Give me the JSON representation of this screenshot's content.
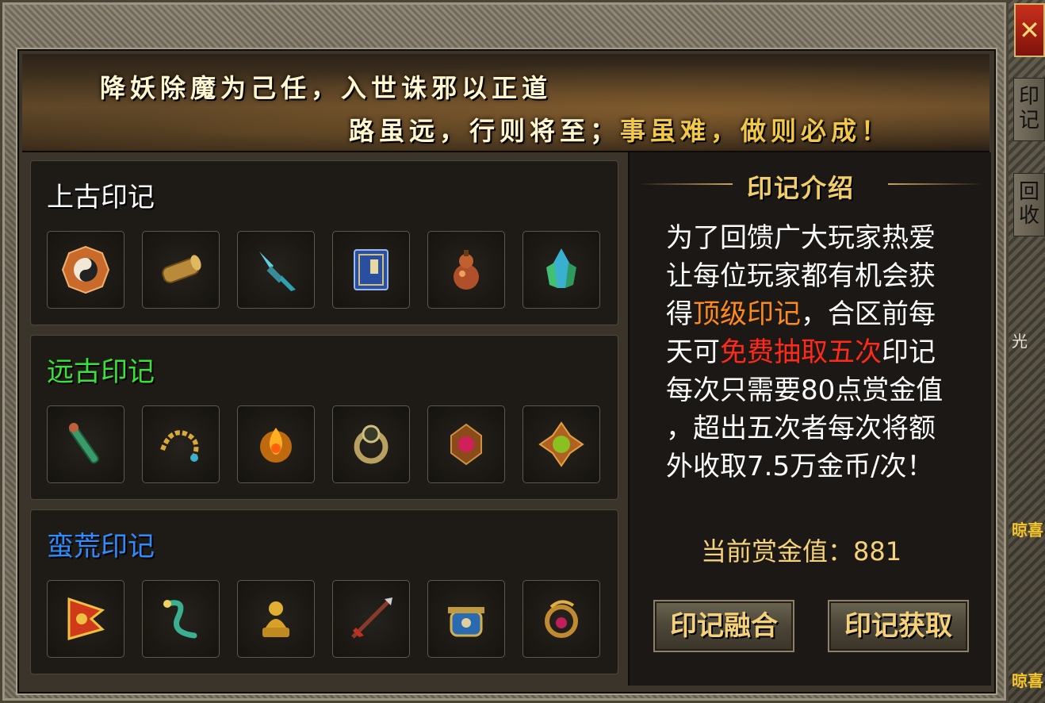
{
  "banner": {
    "line1": "降妖除魔为己任，入世诛邪以正道",
    "line2_a": "路虽远，行则将至；",
    "line2_b": "事虽难，做则必成！"
  },
  "groups": [
    {
      "title": "上古印记",
      "color": "#ffffff",
      "items": [
        "bagua-icon",
        "scroll-icon",
        "dagger-icon",
        "book-icon",
        "gourd-icon",
        "crystal-icon"
      ]
    },
    {
      "title": "远古印记",
      "color": "#39e23a",
      "items": [
        "jade-staff-icon",
        "beads-icon",
        "flame-emblem-icon",
        "ring-icon",
        "ruby-emblem-icon",
        "peridot-emblem-icon"
      ]
    },
    {
      "title": "蛮荒印记",
      "color": "#2f8cff",
      "items": [
        "banner-flag-icon",
        "serpent-icon",
        "buddha-statue-icon",
        "spear-icon",
        "cauldron-icon",
        "dragon-ring-icon"
      ]
    }
  ],
  "intro": {
    "title": "印记介绍",
    "l1": "为了回馈广大玩家热爱",
    "l2": "让每位玩家都有机会获",
    "l3_a": "得",
    "l3_b": "顶级印记",
    "l3_c": "，合区前每",
    "l4_a": "天可",
    "l4_b": "免费抽取五次",
    "l4_c": "印记",
    "l5": "每次只需要80点赏金值",
    "l6": "，超出五次者每次将额",
    "l7": "外收取7.5万金币/次！"
  },
  "bounty": {
    "label": "当前赏金值：",
    "value": "881"
  },
  "buttons": {
    "fuse": "印记融合",
    "obtain": "印记获取"
  },
  "side": {
    "close": "✕",
    "tab1": "印记",
    "tab2": "回收",
    "frag1": "光",
    "frag2": "晾喜",
    "frag3": "晾喜"
  },
  "colors": {
    "orange": "#ff8a1c",
    "red": "#ff2a1a",
    "gold": "#f2cd6a"
  }
}
